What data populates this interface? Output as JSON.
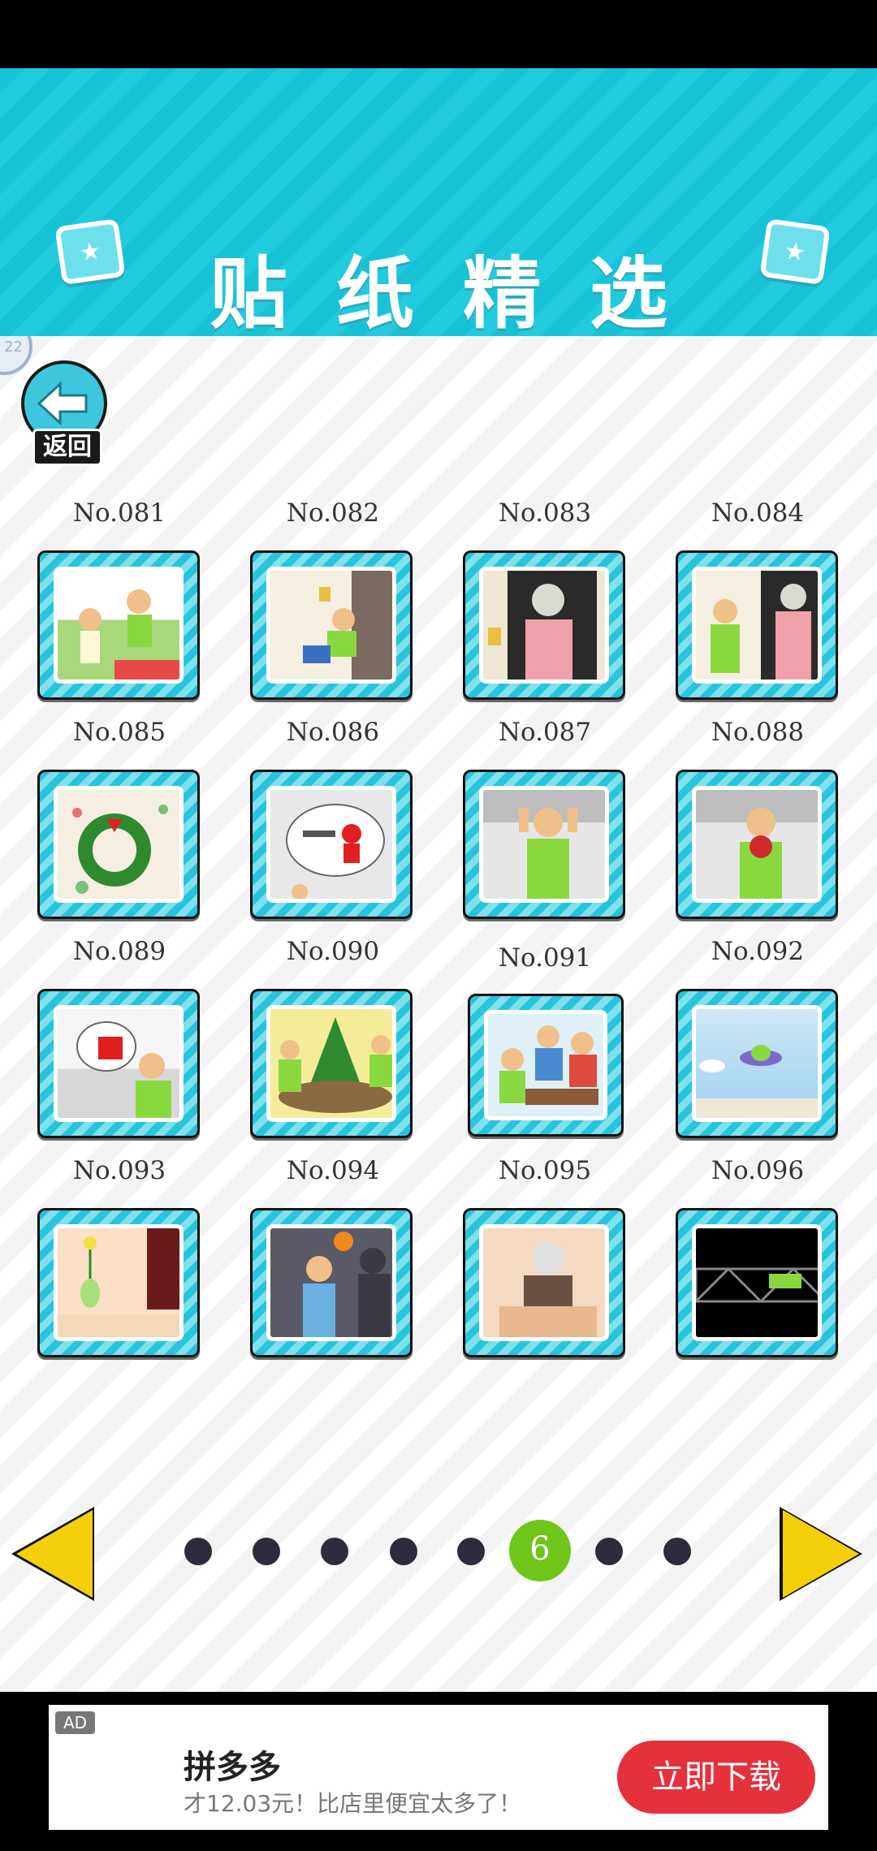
{
  "header": {
    "title": "贴纸精选"
  },
  "back_button": {
    "label": "返回"
  },
  "side_badge": {
    "text": "22"
  },
  "stickers": [
    {
      "label": "No.081"
    },
    {
      "label": "No.082"
    },
    {
      "label": "No.083"
    },
    {
      "label": "No.084"
    },
    {
      "label": "No.085"
    },
    {
      "label": "No.086"
    },
    {
      "label": "No.087"
    },
    {
      "label": "No.088"
    },
    {
      "label": "No.089"
    },
    {
      "label": "No.090"
    },
    {
      "label": "No.091"
    },
    {
      "label": "No.092"
    },
    {
      "label": "No.093"
    },
    {
      "label": "No.094"
    },
    {
      "label": "No.095"
    },
    {
      "label": "No.096"
    }
  ],
  "pager": {
    "current_page": "6",
    "total_dots": 8
  },
  "ad": {
    "tag": "AD",
    "app_name": "拼多多",
    "description": "才12.03元！比店里便宜太多了！",
    "cta": "立即下载"
  },
  "colors": {
    "header": "#18c2d6",
    "active_dot": "#6fc51a",
    "arrow": "#f5cf0a",
    "cta": "#e5313c"
  }
}
